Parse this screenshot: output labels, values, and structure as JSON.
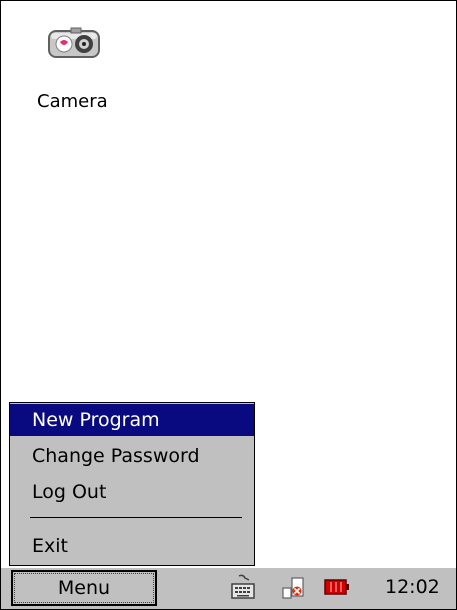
{
  "desktop": {
    "icons": [
      {
        "label": "Camera",
        "icon": "camera-icon"
      }
    ]
  },
  "menu": {
    "items": [
      {
        "label": "New Program",
        "selected": true
      },
      {
        "label": "Change Password",
        "selected": false
      },
      {
        "label": "Log Out",
        "selected": false
      },
      {
        "label": "Exit",
        "selected": false
      }
    ]
  },
  "taskbar": {
    "menu_button_label": "Menu",
    "tray_icons": [
      "keyboard-icon",
      "network-icon",
      "battery-icon"
    ],
    "clock": "12:02"
  },
  "colors": {
    "selection": "#0a0a80",
    "menu_background": "#c0c0c0",
    "battery": "#d00000"
  }
}
